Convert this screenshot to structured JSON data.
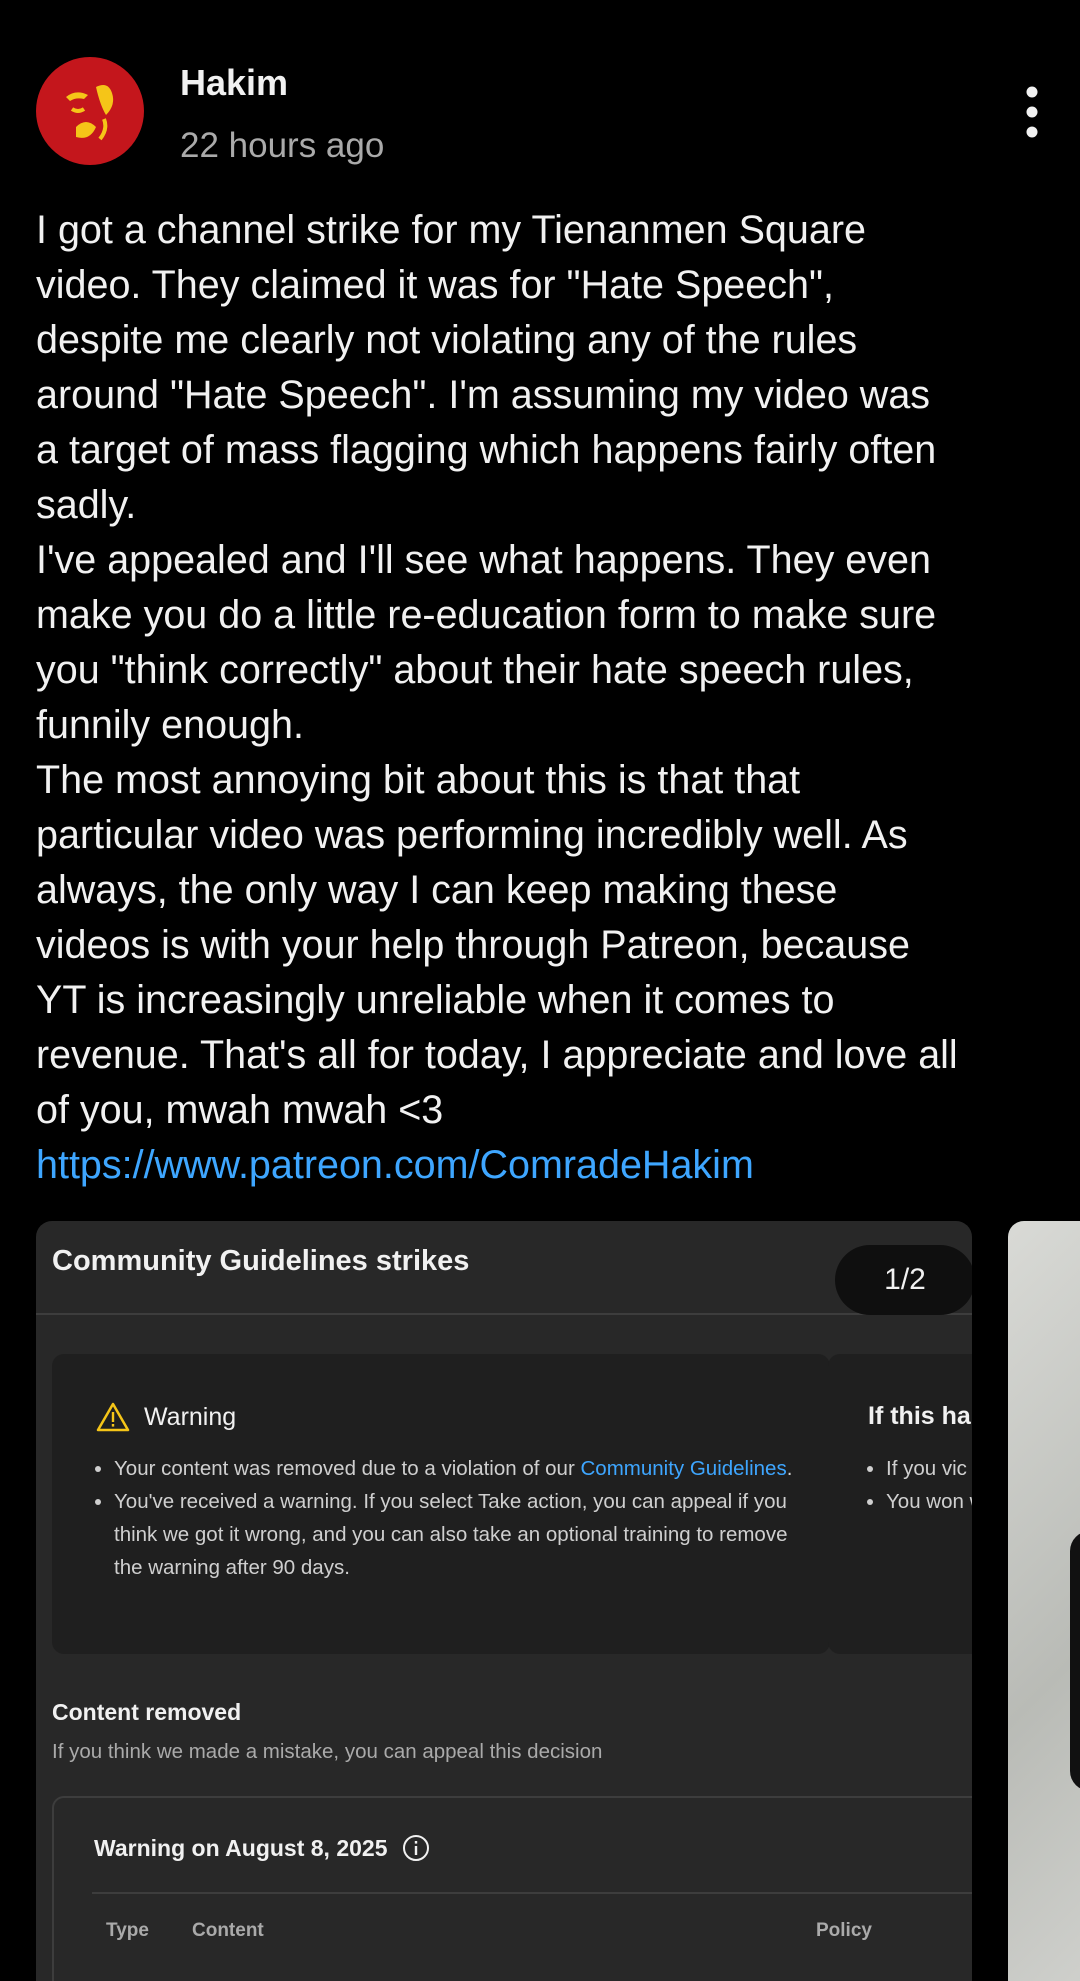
{
  "post": {
    "author": "Hakim",
    "time": "22 hours ago",
    "paragraphs": [
      "I got a channel strike for my Tienanmen Square\nvideo. They claimed it was for \"Hate Speech\",\ndespite me clearly not violating any of the rules\naround \"Hate Speech\". I'm assuming my video was\na target of mass flagging which happens fairly often\nsadly.",
      "I've appealed and I'll see what happens. They even\nmake you do a little re-education form to make sure\nyou \"think correctly\" about their hate speech rules,\nfunnily enough.",
      "The most annoying bit about this is that that\nparticular video was performing incredibly well. As\nalways, the only way I can keep making these\nvideos is with your help through Patreon, because\nYT is increasingly unreliable when it comes to\nrevenue. That's all for today, I appreciate and love all\nof you, mwah mwah <3"
    ],
    "link": "https://www.patreon.com/ComradeHakim",
    "more_icon": "more-vertical-icon"
  },
  "card": {
    "title": "Community Guidelines strikes",
    "page_indicator": "1/2",
    "warning": {
      "title": "Warning",
      "icon": "warning-triangle-icon",
      "item1_text": "Your content was removed due to a violation of our ",
      "item1_link": "Community Guidelines",
      "item1_end": ".",
      "item2": "You've received a warning. If you select Take action, you can appeal if you think we got it wrong, and you can also take an optional training to remove the warning after 90 days."
    },
    "side": {
      "title": "If this hap",
      "item1": "If you vic policy t",
      "item2": "You won week."
    },
    "content_removed_title": "Content removed",
    "content_removed_sub": "If you think we made a mistake, you can appeal this decision",
    "table": {
      "title": "Warning on August 8, 2025",
      "columns": [
        "Type",
        "Content",
        "Policy"
      ]
    }
  },
  "colors": {
    "background": "#000000",
    "link": "#3ea6ff",
    "card": "#282828",
    "avatar": "#c4161c"
  }
}
